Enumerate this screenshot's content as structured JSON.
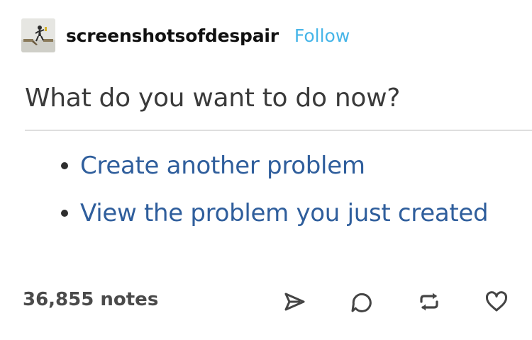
{
  "header": {
    "avatar_icon": "broken-bridge-avatar-icon",
    "blog_name": "screenshotsofdespair",
    "follow_label": "Follow"
  },
  "content": {
    "question": "What do you want to do now?",
    "options": [
      {
        "label": "Create another problem"
      },
      {
        "label": "View the problem you just created"
      }
    ]
  },
  "footer": {
    "notes_count": "36,855 notes",
    "actions": [
      {
        "icon": "share-icon"
      },
      {
        "icon": "reply-icon"
      },
      {
        "icon": "reblog-icon"
      },
      {
        "icon": "heart-icon"
      }
    ]
  },
  "colors": {
    "link_blue": "#2f5e9c",
    "follow_blue": "#46b5e8",
    "text_dark": "#3a3a3a",
    "footer_gray": "#4a4a4a"
  }
}
